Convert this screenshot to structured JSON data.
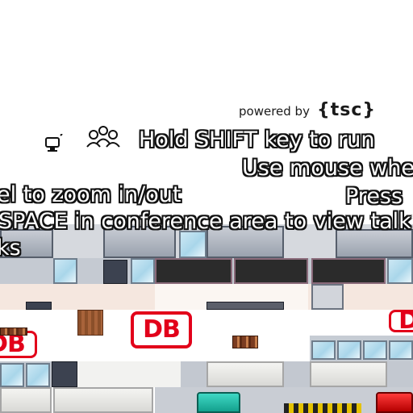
{
  "branding": {
    "powered_by": "powered by",
    "logo_text": "{tsc}"
  },
  "hints": {
    "shift_run": "Hold SHIFT key to run",
    "mouse_wheel_part1": "Use mouse whe",
    "mouse_wheel_part2": "el to zoom in/out",
    "press_space_part1": "Press",
    "press_space_part2": "SPACE in conference area to view talk",
    "press_space_part3": "ks"
  },
  "map": {
    "logo_text": "DB"
  },
  "icons": {
    "screen_share": "screen-share-icon",
    "participants": "participants-icon"
  },
  "colors": {
    "db_red": "#e2001a",
    "teal_seat": "#1fbfa9",
    "red_seat": "#d40000"
  }
}
